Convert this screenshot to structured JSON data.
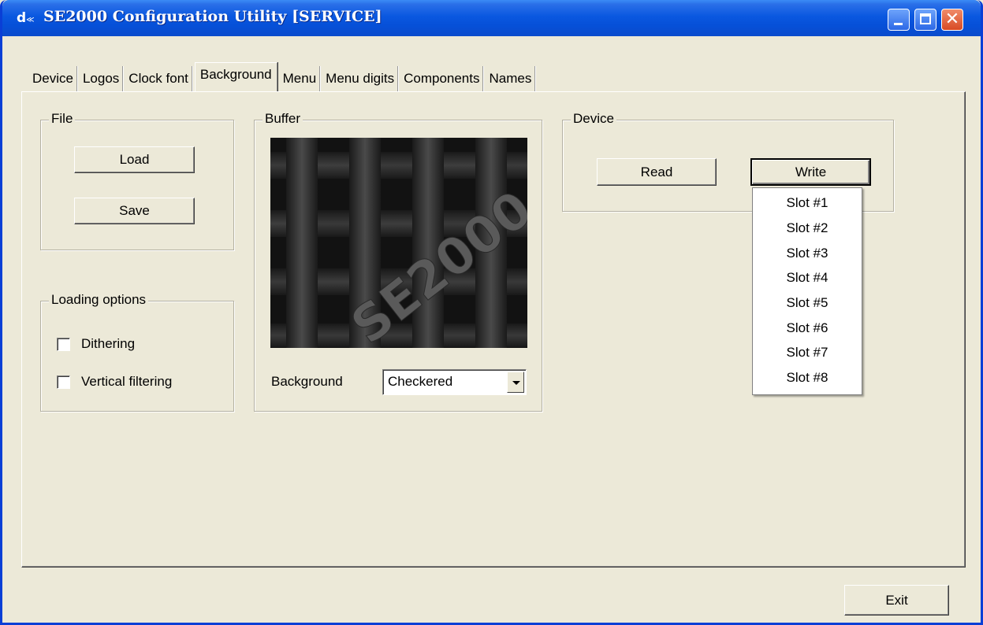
{
  "window": {
    "title": "SE2000 Configuration Utility [SERVICE]",
    "icon_glyph": "d",
    "icon_suffix": "≪"
  },
  "tabs": [
    {
      "label": "Device",
      "active": false
    },
    {
      "label": "Logos",
      "active": false
    },
    {
      "label": "Clock font",
      "active": false
    },
    {
      "label": "Background",
      "active": true
    },
    {
      "label": "Menu",
      "active": false
    },
    {
      "label": "Menu digits",
      "active": false
    },
    {
      "label": "Components",
      "active": false
    },
    {
      "label": "Names",
      "active": false
    }
  ],
  "file_group": {
    "title": "File",
    "load_label": "Load",
    "save_label": "Save"
  },
  "loading_options": {
    "title": "Loading options",
    "dithering_label": "Dithering",
    "dithering_checked": false,
    "vertical_label": "Vertical filtering",
    "vertical_checked": false
  },
  "buffer": {
    "title": "Buffer",
    "preview_text": "SE2000",
    "background_label": "Background",
    "background_value": "Checkered"
  },
  "device": {
    "title": "Device",
    "read_label": "Read",
    "write_label": "Write"
  },
  "write_menu": [
    "Slot #1",
    "Slot #2",
    "Slot #3",
    "Slot #4",
    "Slot #5",
    "Slot #6",
    "Slot #7",
    "Slot #8"
  ],
  "footer": {
    "exit_label": "Exit"
  },
  "colors": {
    "titlebar": "#0a58e0",
    "face": "#ece9d8",
    "preview_bg": "#141414"
  }
}
